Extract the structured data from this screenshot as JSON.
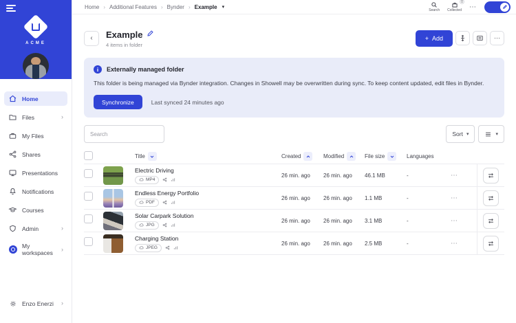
{
  "colors": {
    "accent": "#3144d6",
    "banner_bg": "#e9ecf9",
    "active_nav_bg": "#e9ecfb"
  },
  "topbar": {
    "breadcrumb": {
      "0": "Home",
      "1": "Additional Features",
      "2": "Bynder",
      "3": "Example"
    },
    "search_label": "Search",
    "collected_label": "Collected",
    "collected_count": "0"
  },
  "sidebar": {
    "logo_text": "ACME",
    "items": {
      "0": {
        "label": "Home"
      },
      "1": {
        "label": "Files"
      },
      "2": {
        "label": "My Files"
      },
      "3": {
        "label": "Shares"
      },
      "4": {
        "label": "Presentations"
      },
      "5": {
        "label": "Notifications"
      },
      "6": {
        "label": "Courses"
      },
      "7": {
        "label": "Admin"
      },
      "8": {
        "label": "My workspaces"
      }
    },
    "footer": {
      "label": "Enzo Enerzi"
    }
  },
  "header": {
    "title": "Example",
    "subtitle": "4 items in folder",
    "add_label": "Add"
  },
  "banner": {
    "title": "Externally managed folder",
    "body": "This folder is being managed via Bynder integration. Changes in Showell may be overwritten during sync. To keep content updated, edit files in Bynder.",
    "sync_label": "Synchronize",
    "last_synced": "Last synced 24 minutes ago"
  },
  "toolbar": {
    "search_placeholder": "Search",
    "sort_label": "Sort"
  },
  "table": {
    "columns": {
      "title": "Title",
      "created": "Created",
      "modified": "Modified",
      "size": "File size",
      "languages": "Languages"
    },
    "rows": {
      "0": {
        "title": "Electric Driving",
        "type": "MP4",
        "created": "26 min. ago",
        "modified": "26 min. ago",
        "size": "46.1 MB",
        "languages": "-"
      },
      "1": {
        "title": "Endless Energy Portfolio",
        "type": "PDF",
        "created": "26 min. ago",
        "modified": "26 min. ago",
        "size": "1.1 MB",
        "languages": "-"
      },
      "2": {
        "title": "Solar Carpark Solution",
        "type": "JPG",
        "created": "26 min. ago",
        "modified": "26 min. ago",
        "size": "3.1 MB",
        "languages": "-"
      },
      "3": {
        "title": "Charging Station",
        "type": "JPEG",
        "created": "26 min. ago",
        "modified": "26 min. ago",
        "size": "2.5 MB",
        "languages": "-"
      }
    }
  }
}
